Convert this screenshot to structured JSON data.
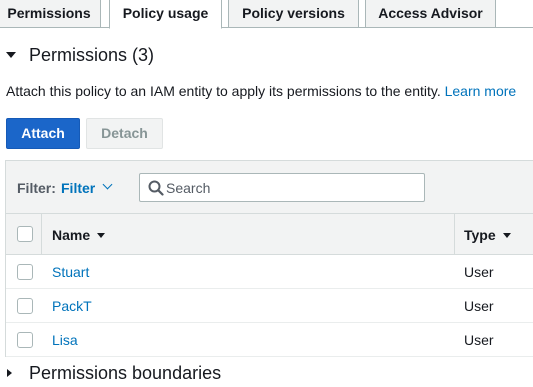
{
  "tabs": [
    {
      "label": "Permissions",
      "active": false
    },
    {
      "label": "Policy usage",
      "active": true
    },
    {
      "label": "Policy versions",
      "active": false
    },
    {
      "label": "Access Advisor",
      "active": false
    }
  ],
  "permissions_section": {
    "title": "Permissions (3)",
    "expanded": true,
    "description": "Attach this policy to an IAM entity to apply its permissions to the entity.",
    "learn_more": "Learn more"
  },
  "buttons": {
    "attach": "Attach",
    "detach": "Detach",
    "detach_disabled": true
  },
  "filter": {
    "label": "Filter:",
    "value": "Filter",
    "search_placeholder": "Search"
  },
  "table": {
    "columns": {
      "name": "Name",
      "type": "Type"
    },
    "rows": [
      {
        "name": "Stuart",
        "type": "User"
      },
      {
        "name": "PackT",
        "type": "User"
      },
      {
        "name": "Lisa",
        "type": "User"
      }
    ]
  },
  "boundaries_section": {
    "title": "Permissions boundaries",
    "expanded": false
  },
  "colors": {
    "link": "#0073bb",
    "primary_button": "#1b66c9",
    "header_bg": "#f2f3f3",
    "border": "#d5dbdb"
  },
  "icons": {
    "search": "search-icon",
    "filter_dropdown": "chevron-down-icon",
    "section_expanded": "caret-down-icon",
    "section_collapsed": "caret-right-icon",
    "sort": "sort-caret-down-icon"
  }
}
